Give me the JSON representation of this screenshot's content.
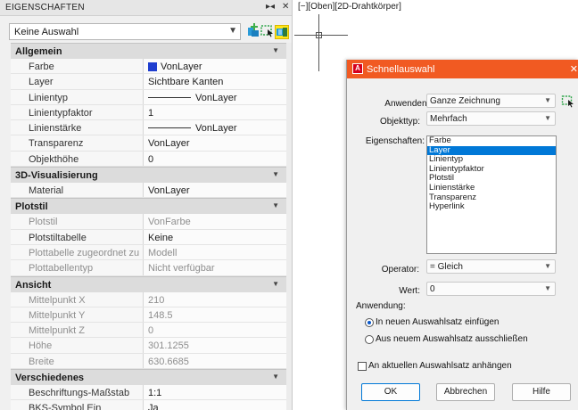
{
  "palette": {
    "title": "EIGENSCHAFTEN",
    "pin_glyph": "▸◂",
    "close_glyph": "✕",
    "selection": "Keine Auswahl",
    "categories": [
      {
        "name": "Allgemein",
        "rows": [
          {
            "name": "Farbe",
            "value": "VonLayer",
            "swatch": "#1f3ecf"
          },
          {
            "name": "Layer",
            "value": "Sichtbare Kanten"
          },
          {
            "name": "Linientyp",
            "value": "VonLayer",
            "line": true
          },
          {
            "name": "Linientypfaktor",
            "value": "1"
          },
          {
            "name": "Linienstärke",
            "value": "VonLayer",
            "line": true
          },
          {
            "name": "Transparenz",
            "value": "VonLayer"
          },
          {
            "name": "Objekthöhe",
            "value": "0"
          }
        ]
      },
      {
        "name": "3D-Visualisierung",
        "rows": [
          {
            "name": "Material",
            "value": "VonLayer"
          }
        ]
      },
      {
        "name": "Plotstil",
        "rows": [
          {
            "name": "Plotstil",
            "value": "VonFarbe",
            "disabled": true
          },
          {
            "name": "Plotstiltabelle",
            "value": "Keine"
          },
          {
            "name": "Plottabelle zugeordnet zu",
            "value": "Modell",
            "disabled": true
          },
          {
            "name": "Plottabellentyp",
            "value": "Nicht verfügbar",
            "disabled": true
          }
        ]
      },
      {
        "name": "Ansicht",
        "rows": [
          {
            "name": "Mittelpunkt X",
            "value": "210",
            "disabled": true
          },
          {
            "name": "Mittelpunkt Y",
            "value": "148.5",
            "disabled": true
          },
          {
            "name": "Mittelpunkt Z",
            "value": "0",
            "disabled": true
          },
          {
            "name": "Höhe",
            "value": "301.1255",
            "disabled": true
          },
          {
            "name": "Breite",
            "value": "630.6685",
            "disabled": true
          }
        ]
      },
      {
        "name": "Verschiedenes",
        "rows": [
          {
            "name": "Beschriftungs-Maßstab",
            "value": "1:1"
          },
          {
            "name": "BKS-Symbol Ein",
            "value": "Ja"
          }
        ]
      }
    ]
  },
  "viewport": {
    "label": "[−][Oben][2D-Drahtkörper]"
  },
  "dialog": {
    "title": "Schnellauswahl",
    "logo": "A",
    "close_glyph": "✕",
    "apply_to_label": "Anwenden auf:",
    "apply_to_value": "Ganze Zeichnung",
    "object_type_label": "Objekttyp:",
    "object_type_value": "Mehrfach",
    "properties_label": "Eigenschaften:",
    "properties": [
      "Farbe",
      "Layer",
      "Linientyp",
      "Linientypfaktor",
      "Plotstil",
      "Linienstärke",
      "Transparenz",
      "Hyperlink"
    ],
    "selected_property": "Layer",
    "operator_label": "Operator:",
    "operator_value": "= Gleich",
    "value_label": "Wert:",
    "value_value": "0",
    "apply_heading": "Anwendung:",
    "radio_include": "In neuen Auswahlsatz einfügen",
    "radio_exclude": "Aus neuem Auswahlsatz ausschließen",
    "append_checkbox": "An aktuellen Auswahlsatz anhängen",
    "ok": "OK",
    "cancel": "Abbrechen",
    "help": "Hilfe"
  },
  "colors": {
    "dialog_title_bar": "#f15a22",
    "quick_select_highlight": "#ffe51a",
    "selection_highlight": "#0078d7"
  },
  "icons": [
    "chevron-down-icon",
    "pin-icon",
    "close-icon",
    "pickadd-icon",
    "select-objects-icon",
    "quick-select-icon",
    "autocad-logo-icon"
  ]
}
